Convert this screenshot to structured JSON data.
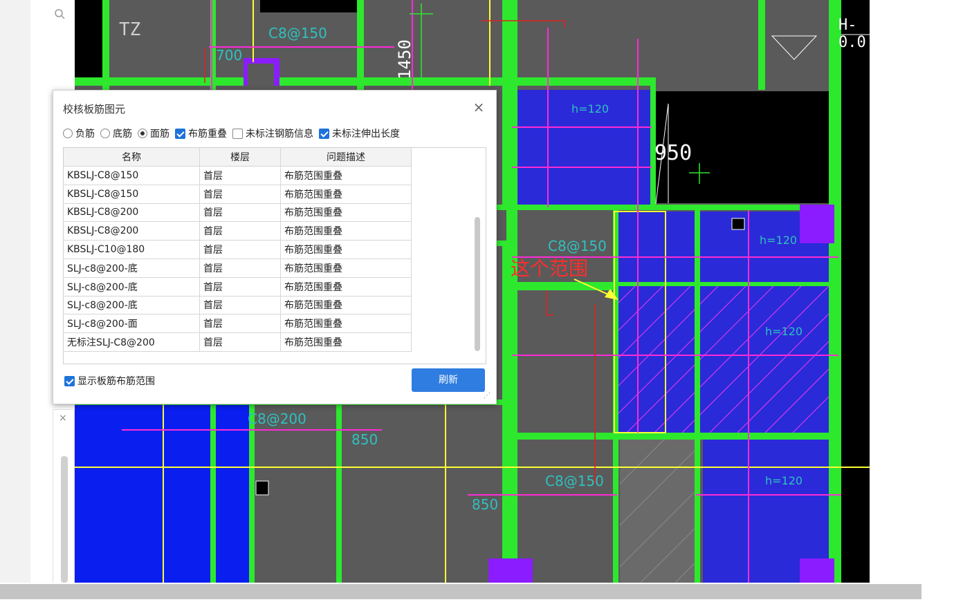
{
  "dialog": {
    "title": "校核板筋图元",
    "options": [
      {
        "label": "负筋",
        "type": "radio",
        "selected": false
      },
      {
        "label": "底筋",
        "type": "radio",
        "selected": false
      },
      {
        "label": "面筋",
        "type": "radio",
        "selected": true
      },
      {
        "label": "布筋重叠",
        "type": "checkbox",
        "checked": true
      },
      {
        "label": "未标注钢筋信息",
        "type": "checkbox",
        "checked": false
      },
      {
        "label": "未标注伸出长度",
        "type": "checkbox",
        "checked": true
      }
    ],
    "table": {
      "headers": [
        "名称",
        "楼层",
        "问题描述"
      ],
      "rows": [
        [
          "KBSLJ-C8@150",
          "首层",
          "布筋范围重叠"
        ],
        [
          "KBSLJ-C8@150",
          "首层",
          "布筋范围重叠"
        ],
        [
          "KBSLJ-C8@200",
          "首层",
          "布筋范围重叠"
        ],
        [
          "KBSLJ-C8@200",
          "首层",
          "布筋范围重叠"
        ],
        [
          "KBSLJ-C10@180",
          "首层",
          "布筋范围重叠"
        ],
        [
          "SLJ-c8@200-底",
          "首层",
          "布筋范围重叠"
        ],
        [
          "SLJ-c8@200-底",
          "首层",
          "布筋范围重叠"
        ],
        [
          "SLJ-c8@200-底",
          "首层",
          "布筋范围重叠"
        ],
        [
          "SLJ-c8@200-面",
          "首层",
          "布筋范围重叠"
        ],
        [
          "无标注SLJ-C8@200",
          "首层",
          "布筋范围重叠"
        ]
      ]
    },
    "show_range_label": "显示板筋布筋范围",
    "show_range_checked": true,
    "refresh_label": "刷新"
  },
  "cad_labels": {
    "tz": "TZ",
    "h0": "H-0.0",
    "h120_a": "h=120",
    "h120_b": "h=120",
    "h120_c": "h=120",
    "h120_d": "h=120",
    "dim_1450": "1450",
    "dim_950": "950",
    "dim_700": "700",
    "c8_150_a": "C8@150",
    "c8_150_b": "C8@150",
    "c8_150_c": "C8@150",
    "c8_200": "C8@200",
    "n850_a": "850",
    "n850_b": "850"
  },
  "annotation": {
    "text": "这个范围",
    "color": "#ff2d2d"
  },
  "colors": {
    "wall_green": "#2ee82e",
    "slab_blue": "#2a2ad8",
    "rebar_magenta": "#ff2bd6",
    "axis_yellow": "#ffff33",
    "accent_button": "#2f7de1"
  }
}
